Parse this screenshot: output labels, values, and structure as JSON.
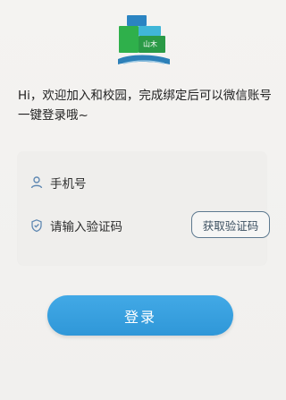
{
  "logo": {
    "badge_text": "山木",
    "icon": "school-logo"
  },
  "intro": {
    "text": "Hi，欢迎加入和校园，完成绑定后可以微信账号一键登录哦~"
  },
  "form": {
    "phone": {
      "placeholder": "手机号",
      "icon": "user-icon"
    },
    "code": {
      "placeholder": "请输入验证码",
      "icon": "shield-icon",
      "button_label": "获取验证码"
    }
  },
  "login": {
    "label": "登录"
  },
  "colors": {
    "primary": "#3aa2e2",
    "logo_green": "#3cab3c",
    "logo_blue": "#2c7fb0"
  }
}
